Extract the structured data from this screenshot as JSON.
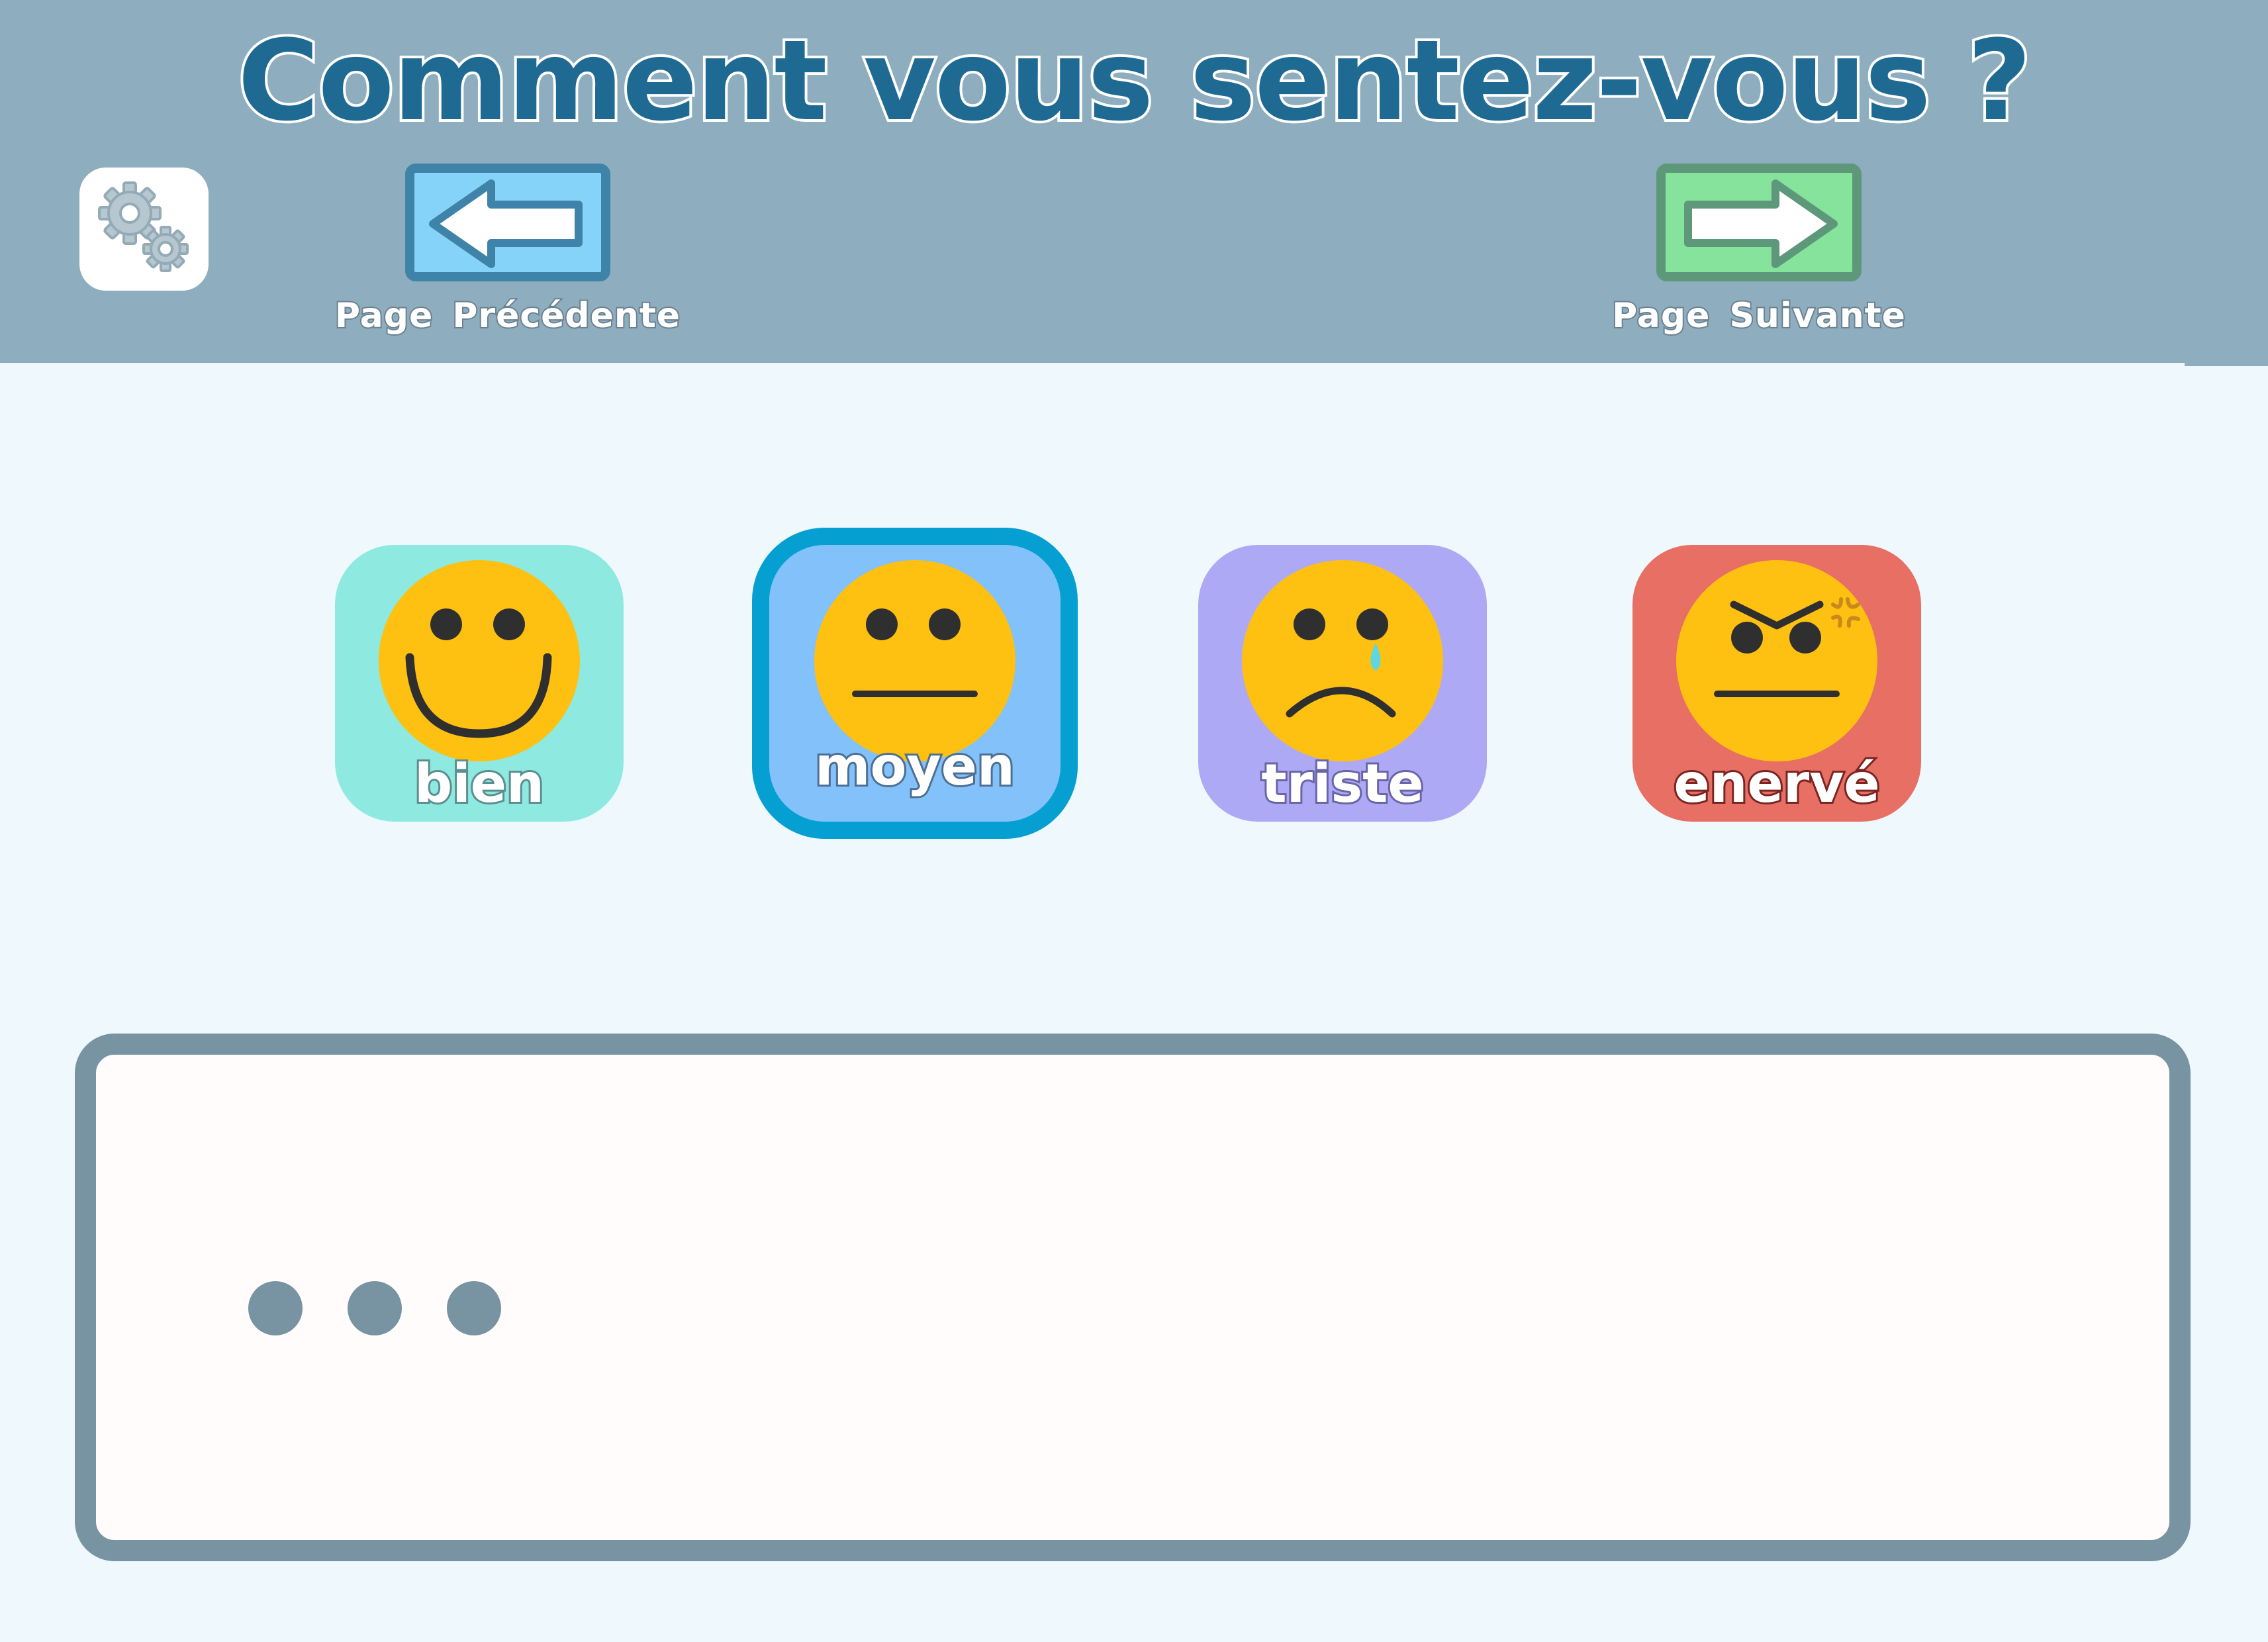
{
  "header": {
    "title": "Comment vous sentez-vous ?",
    "settings_icon": "gears-icon",
    "prev_label": "Page Précédente",
    "next_label": "Page Suivante",
    "prev_icon": "arrow-left-icon",
    "next_icon": "arrow-right-icon"
  },
  "moods": [
    {
      "label": "bien",
      "icon": "happy-face-icon",
      "color": "#8ee9e0",
      "selected": false
    },
    {
      "label": "moyen",
      "icon": "neutral-face-icon",
      "color": "#82c1fa",
      "selected": true
    },
    {
      "label": "triste",
      "icon": "sad-face-icon",
      "color": "#aea9f5",
      "selected": false
    },
    {
      "label": "enervé",
      "icon": "angry-face-icon",
      "color": "#e76f64",
      "selected": false
    }
  ],
  "message": {
    "typing_icon": "ellipsis-icon"
  },
  "colors": {
    "header_bg": "#8eadbe",
    "page_bg": "#eff9fd",
    "title": "#1f6a92",
    "face": "#fec011",
    "selected_border": "#069fd1",
    "message_border": "#7894a3"
  }
}
